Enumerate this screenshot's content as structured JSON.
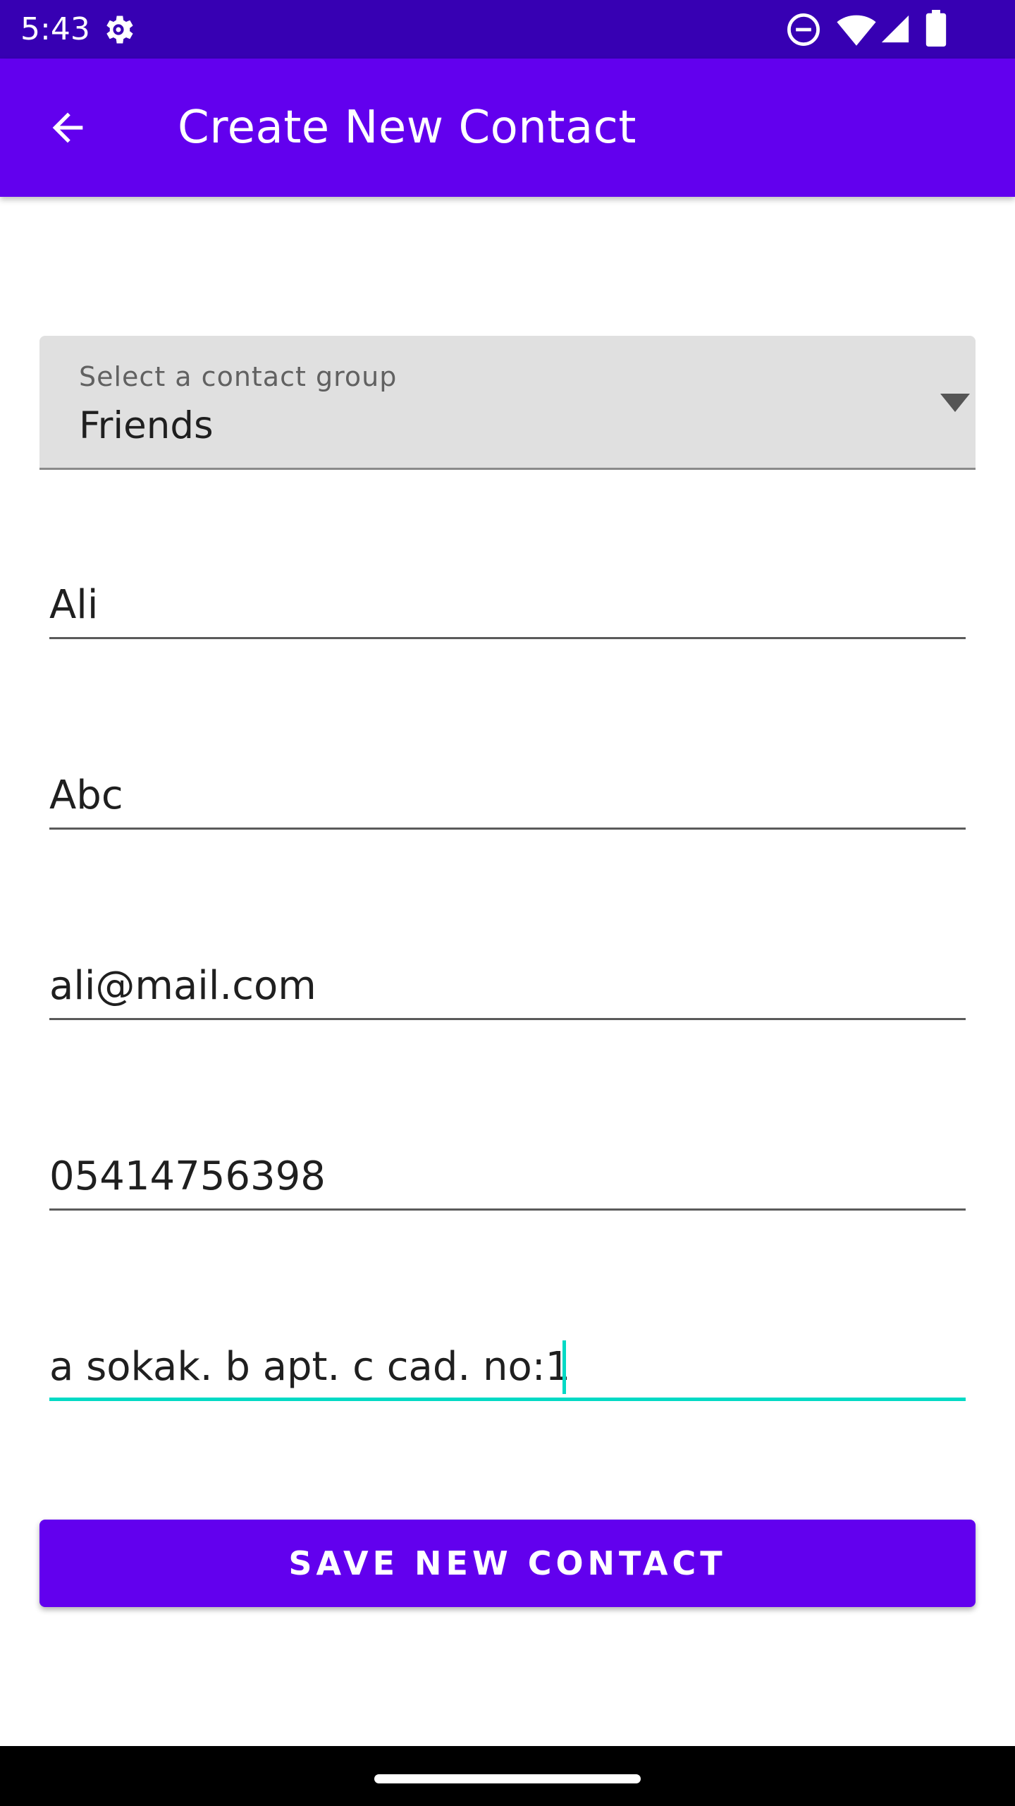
{
  "status_bar": {
    "time": "5:43",
    "icons": [
      "settings-gear-icon",
      "do-not-disturb-icon",
      "wifi-icon",
      "cellular-signal-icon",
      "battery-icon"
    ]
  },
  "app_bar": {
    "title": "Create New Contact",
    "back_icon": "arrow-back-icon"
  },
  "form": {
    "group_select": {
      "label": "Select a contact group",
      "value": "Friends",
      "icon": "dropdown-arrow-icon"
    },
    "fields": {
      "first_name": "Ali",
      "last_name": "Abc",
      "email": "ali@mail.com",
      "phone": "05414756398",
      "address": "a sokak. b apt. c cad. no:1"
    },
    "focused_field": "address",
    "save_label": "SAVE NEW CONTACT"
  },
  "colors": {
    "status_bar": "#3700b3",
    "primary": "#6200ee",
    "accent": "#03dac5",
    "dropdown_background": "#e0e0e0"
  }
}
